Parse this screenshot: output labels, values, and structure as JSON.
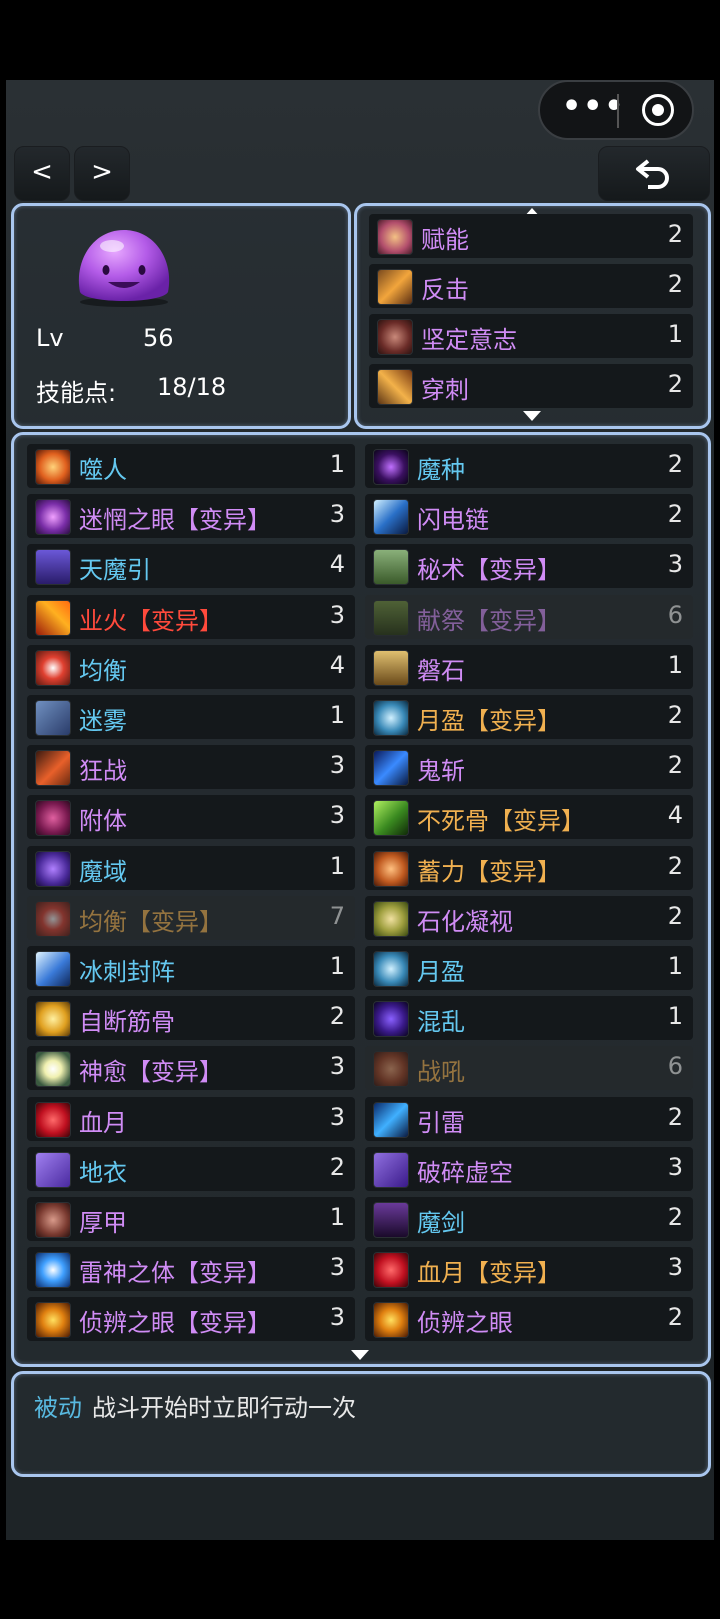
{
  "colors": {
    "cyan": "#64c8f0",
    "orange": "#f0b050",
    "purple": "#d08cf5",
    "red": "#ff4a3c",
    "panel_border": "#a9c6ee"
  },
  "nav": {
    "prev": "<",
    "next": ">",
    "back_icon": "back-arrow-icon"
  },
  "capsule": {
    "more_icon": "more-dots-icon",
    "close_icon": "target-circle-icon"
  },
  "pet": {
    "lv_label": "Lv",
    "level": "56",
    "skill_points_label": "技能点:",
    "skill_points": "18/18",
    "avatar_icon": "purple-slime-icon"
  },
  "innate_skills": [
    {
      "name": "赋能",
      "level": "2",
      "color": "purple",
      "icon": "empower-icon"
    },
    {
      "name": "反击",
      "level": "2",
      "color": "purple",
      "icon": "counter-icon"
    },
    {
      "name": "坚定意志",
      "level": "1",
      "color": "purple",
      "icon": "resolve-icon"
    },
    {
      "name": "穿刺",
      "level": "2",
      "color": "purple",
      "icon": "pierce-icon"
    }
  ],
  "skills_left": [
    {
      "name": "噬人",
      "level": "1",
      "color": "cyan",
      "icon": "devour-icon",
      "dim": false
    },
    {
      "name": "迷惘之眼【变异】",
      "level": "3",
      "color": "purple",
      "icon": "confused-eye-icon",
      "dim": false
    },
    {
      "name": "天魔引",
      "level": "4",
      "color": "cyan",
      "icon": "demon-lure-icon",
      "dim": false
    },
    {
      "name": "业火【变异】",
      "level": "3",
      "color": "red",
      "icon": "karma-fire-icon",
      "dim": false
    },
    {
      "name": "均衡",
      "level": "4",
      "color": "cyan",
      "icon": "balance-icon",
      "dim": false
    },
    {
      "name": "迷雾",
      "level": "1",
      "color": "cyan",
      "icon": "mist-icon",
      "dim": false
    },
    {
      "name": "狂战",
      "level": "3",
      "color": "purple",
      "icon": "berserk-icon",
      "dim": false
    },
    {
      "name": "附体",
      "level": "3",
      "color": "purple",
      "icon": "possess-icon",
      "dim": false
    },
    {
      "name": "魔域",
      "level": "1",
      "color": "cyan",
      "icon": "demon-realm-icon",
      "dim": false
    },
    {
      "name": "均衡【变异】",
      "level": "7",
      "color": "orange",
      "icon": "balance-mutant-icon",
      "dim": true
    },
    {
      "name": "冰刺封阵",
      "level": "1",
      "color": "cyan",
      "icon": "ice-spike-icon",
      "dim": false
    },
    {
      "name": "自断筋骨",
      "level": "2",
      "color": "purple",
      "icon": "self-break-icon",
      "dim": false
    },
    {
      "name": "神愈【变异】",
      "level": "3",
      "color": "purple",
      "icon": "divine-heal-icon",
      "dim": false
    },
    {
      "name": "血月",
      "level": "3",
      "color": "purple",
      "icon": "blood-moon-icon",
      "dim": false
    },
    {
      "name": "地衣",
      "level": "2",
      "color": "cyan",
      "icon": "lichen-icon",
      "dim": false
    },
    {
      "name": "厚甲",
      "level": "1",
      "color": "purple",
      "icon": "thick-armor-icon",
      "dim": false
    },
    {
      "name": "雷神之体【变异】",
      "level": "3",
      "color": "purple",
      "icon": "thunder-body-icon",
      "dim": false
    },
    {
      "name": "侦辨之眼【变异】",
      "level": "3",
      "color": "purple",
      "icon": "detect-eye-icon",
      "dim": false
    }
  ],
  "skills_right": [
    {
      "name": "魔种",
      "level": "2",
      "color": "cyan",
      "icon": "demon-seed-icon",
      "dim": false
    },
    {
      "name": "闪电链",
      "level": "2",
      "color": "purple",
      "icon": "chain-lightning-icon",
      "dim": false
    },
    {
      "name": "秘术【变异】",
      "level": "3",
      "color": "purple",
      "icon": "arcane-icon",
      "dim": false
    },
    {
      "name": "献祭【变异】",
      "level": "6",
      "color": "purple",
      "icon": "sacrifice-icon",
      "dim": true
    },
    {
      "name": "磐石",
      "level": "1",
      "color": "purple",
      "icon": "bedrock-icon",
      "dim": false
    },
    {
      "name": "月盈【变异】",
      "level": "2",
      "color": "orange",
      "icon": "moon-full-mutant-icon",
      "dim": false
    },
    {
      "name": "鬼斩",
      "level": "2",
      "color": "purple",
      "icon": "ghost-slash-icon",
      "dim": false
    },
    {
      "name": "不死骨【变异】",
      "level": "4",
      "color": "orange",
      "icon": "undead-bone-icon",
      "dim": false
    },
    {
      "name": "蓄力【变异】",
      "level": "2",
      "color": "orange",
      "icon": "charge-icon",
      "dim": false
    },
    {
      "name": "石化凝视",
      "level": "2",
      "color": "purple",
      "icon": "petrify-gaze-icon",
      "dim": false
    },
    {
      "name": "月盈",
      "level": "1",
      "color": "cyan",
      "icon": "moon-full-icon",
      "dim": false
    },
    {
      "name": "混乱",
      "level": "1",
      "color": "cyan",
      "icon": "chaos-icon",
      "dim": false
    },
    {
      "name": "战吼",
      "level": "6",
      "color": "orange",
      "icon": "war-cry-icon",
      "dim": true
    },
    {
      "name": "引雷",
      "level": "2",
      "color": "purple",
      "icon": "thunder-lure-icon",
      "dim": false
    },
    {
      "name": "破碎虚空",
      "level": "3",
      "color": "purple",
      "icon": "shatter-void-icon",
      "dim": false
    },
    {
      "name": "魔剑",
      "level": "2",
      "color": "cyan",
      "icon": "demon-sword-icon",
      "dim": false
    },
    {
      "name": "血月【变异】",
      "level": "3",
      "color": "orange",
      "icon": "blood-moon-mutant-icon",
      "dim": false
    },
    {
      "name": "侦辨之眼",
      "level": "2",
      "color": "purple",
      "icon": "detect-eye-icon",
      "dim": false
    }
  ],
  "description": {
    "tag": "被动",
    "text": "战斗开始时立即行动一次"
  }
}
